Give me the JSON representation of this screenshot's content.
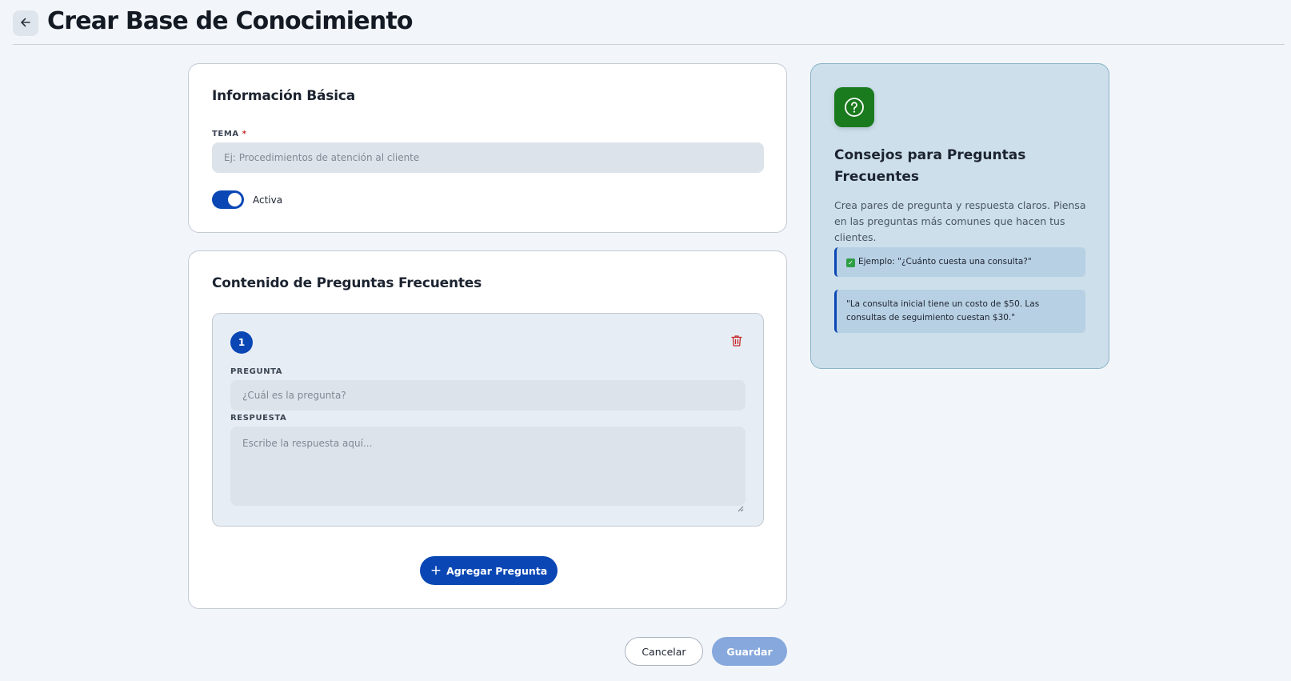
{
  "header": {
    "back_icon": "arrow-left-icon",
    "title": "Crear Base de Conocimiento"
  },
  "basic_info": {
    "title": "Información Básica",
    "tema": {
      "label": "TEMA",
      "required_mark": "*",
      "value": "",
      "placeholder": "Ej: Procedimientos de atención al cliente"
    },
    "active_toggle": {
      "label": "Activa",
      "checked": true
    }
  },
  "faq": {
    "title": "Contenido de Preguntas Frecuentes",
    "items": [
      {
        "number": "1",
        "question_label": "PREGUNTA",
        "question_value": "",
        "question_placeholder": "¿Cuál es la pregunta?",
        "answer_label": "RESPUESTA",
        "answer_value": "",
        "answer_placeholder": "Escribe la respuesta aquí...",
        "delete_icon": "trash-icon"
      }
    ],
    "add_button": {
      "icon": "plus-icon",
      "label": "Agregar Pregunta"
    }
  },
  "tips": {
    "icon": "question-circle-icon",
    "title": "Consejos para Preguntas Frecuentes",
    "description": "Crea pares de pregunta y respuesta claros. Piensa en las preguntas más comunes que hacen tus clientes.",
    "examples": [
      {
        "icon": "check-box-icon",
        "text": "Ejemplo: \"¿Cuánto cuesta una consulta?\""
      },
      {
        "icon": "",
        "text": "\"La consulta inicial tiene un costo de $50. Las consultas de seguimiento cuestan $30.\""
      }
    ]
  },
  "footer": {
    "cancel_label": "Cancelar",
    "save_label": "Guardar"
  },
  "colors": {
    "primary": "#0a47b5",
    "background": "#f2f6fb",
    "tips_background": "#ccdfeb",
    "tips_icon_background": "#1a7a1e",
    "save_disabled": "#86a8dc",
    "delete": "#c62828"
  }
}
